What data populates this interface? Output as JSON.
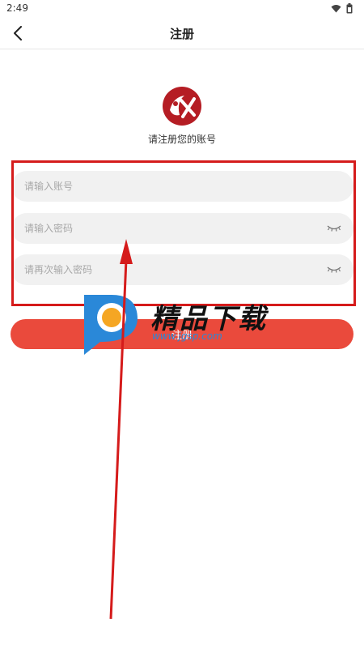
{
  "status_bar": {
    "time": "2:49"
  },
  "nav": {
    "title": "注册"
  },
  "header": {
    "subtitle": "请注册您的账号"
  },
  "form": {
    "account_placeholder": "请输入账号",
    "password_placeholder": "请输入密码",
    "confirm_placeholder": "请再次输入密码",
    "submit_label": "注册"
  },
  "watermark": {
    "brand": "精品下载",
    "url": "www.jgsp.com"
  },
  "colors": {
    "accent": "#ea4a3c",
    "annotation": "#d51b1b",
    "watermark_blue": "#2a88d8",
    "watermark_orange": "#f5a623"
  },
  "icons": [
    "wifi-icon",
    "battery-icon",
    "back-arrow-icon",
    "app-logo-icon",
    "eye-closed-icon",
    "watermark-logo-icon"
  ]
}
